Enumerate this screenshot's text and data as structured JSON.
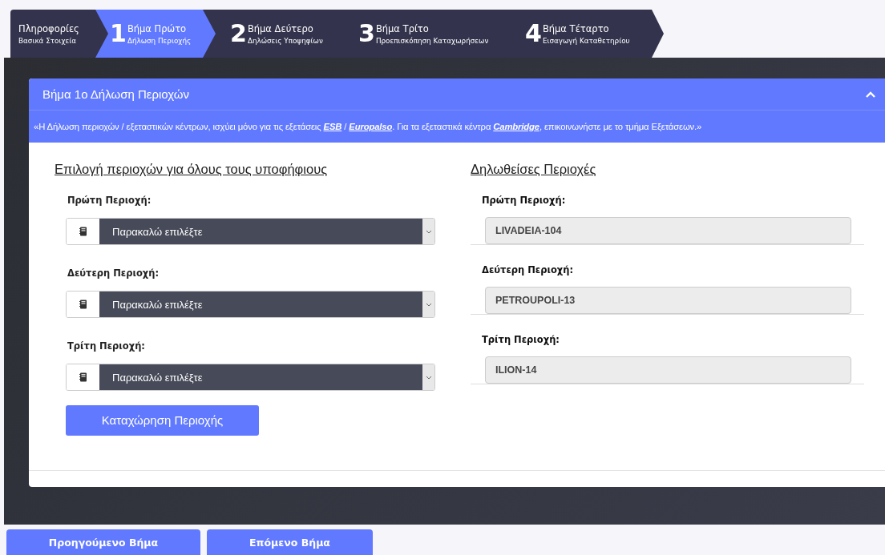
{
  "wizard": {
    "steps": [
      {
        "title": "Πληροφορίες",
        "subtitle": "Βασικά Στοιχεία",
        "selected": false
      },
      {
        "number": "1",
        "title": "Βήμα Πρώτο",
        "subtitle": "Δήλωση Περιοχής",
        "selected": true
      },
      {
        "number": "2",
        "title": "Βήμα Δεύτερο",
        "subtitle": "Δηλώσεις Υποψηφίων",
        "selected": false
      },
      {
        "number": "3",
        "title": "Βήμα Τρίτο",
        "subtitle": "Προεπισκόπηση Καταχωρήσεων",
        "selected": false
      },
      {
        "number": "4",
        "title": "Βήμα Τέταρτο",
        "subtitle": "Εισαγωγή Καταθετηρίου",
        "selected": false
      }
    ]
  },
  "panel": {
    "title": "Βήμα 1ο Δήλωση Περιοχών",
    "expanded": true,
    "notice": [
      {
        "kind": "text",
        "text": "«Η Δήλωση περιοχών / εξεταστικών κέντρων, ισχύει μόνο για τις εξετάσεις "
      },
      {
        "kind": "link",
        "text": "ESB"
      },
      {
        "kind": "text",
        "text": " / "
      },
      {
        "kind": "link",
        "text": "Europalso"
      },
      {
        "kind": "text",
        "text": ". Για τα εξεταστικά κέντρα "
      },
      {
        "kind": "link",
        "text": "Cambridge"
      },
      {
        "kind": "text",
        "text": ", επικοινωνήστε με το τμήμα Εξετάσεων.»"
      }
    ],
    "selection": {
      "heading": "Επιλογή περιοχών για όλους τους υποφήφιους",
      "selects": [
        {
          "label": "Πρώτη Περιοχή:",
          "value": "Παρακαλώ επιλέξτε"
        },
        {
          "label": "Δεύτερη Περιοχή:",
          "value": "Παρακαλώ επιλέξτε"
        },
        {
          "label": "Τρίτη Περιοχή:",
          "value": "Παρακαλώ επιλέξτε"
        }
      ],
      "submit_button": "Καταχώρηση Περιοχής"
    },
    "declared": {
      "heading": "Δηλωθείσες Περιοχές",
      "fields": [
        {
          "label": "Πρώτη Περιοχή:",
          "value": "LIVADEIA-104",
          "disabled": true
        },
        {
          "label": "Δεύτερη Περιοχή:",
          "value": "PETROUPOLI-13",
          "disabled": true
        },
        {
          "label": "Τρίτη Περιοχή:",
          "value": "ILION-14",
          "disabled": true
        }
      ]
    }
  },
  "footer_buttons": [
    "Προηγούμενο Βήμα",
    "Επόμενο Βήμα"
  ]
}
